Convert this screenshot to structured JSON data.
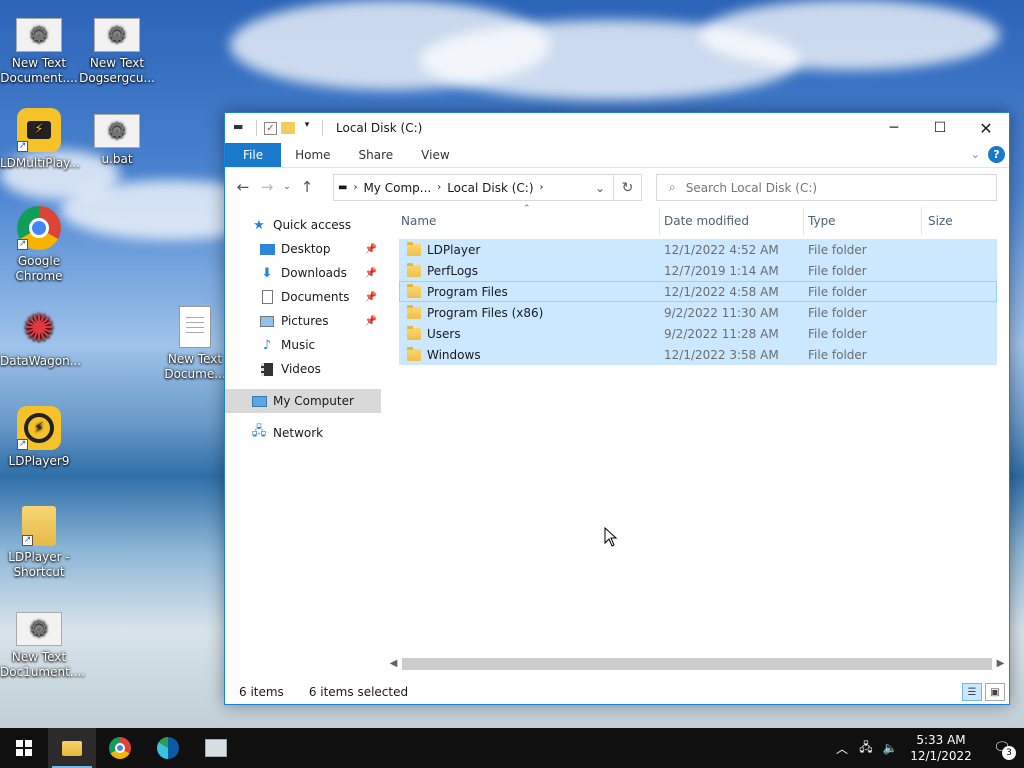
{
  "desktop": {
    "icons": [
      {
        "label": "New Text Document...."
      },
      {
        "label": "New Text Dogsergcu..."
      },
      {
        "label": "LDMultiPlay..."
      },
      {
        "label": "u.bat"
      },
      {
        "label": "Google Chrome"
      },
      {
        "label": "DataWagon..."
      },
      {
        "label": "New Text Docume..."
      },
      {
        "label": "LDPlayer9"
      },
      {
        "label": "LDPlayer - Shortcut"
      },
      {
        "label": "New Text Doc1ument...."
      }
    ]
  },
  "window": {
    "title": "Local Disk (C:)",
    "ribbon_tabs": [
      "File",
      "Home",
      "Share",
      "View"
    ],
    "address": {
      "crumbs": [
        "My Comp...",
        "Local Disk (C:)"
      ]
    },
    "search": {
      "placeholder": "Search Local Disk (C:)"
    },
    "nav": {
      "quick_access": "Quick access",
      "items": [
        "Desktop",
        "Downloads",
        "Documents",
        "Pictures",
        "Music",
        "Videos"
      ],
      "my_computer": "My Computer",
      "network": "Network"
    },
    "columns": [
      "Name",
      "Date modified",
      "Type",
      "Size"
    ],
    "rows": [
      {
        "name": "LDPlayer",
        "date": "12/1/2022 4:52 AM",
        "type": "File folder"
      },
      {
        "name": "PerfLogs",
        "date": "12/7/2019 1:14 AM",
        "type": "File folder"
      },
      {
        "name": "Program Files",
        "date": "12/1/2022 4:58 AM",
        "type": "File folder"
      },
      {
        "name": "Program Files (x86)",
        "date": "9/2/2022 11:30 AM",
        "type": "File folder"
      },
      {
        "name": "Users",
        "date": "9/2/2022 11:28 AM",
        "type": "File folder"
      },
      {
        "name": "Windows",
        "date": "12/1/2022 3:58 AM",
        "type": "File folder"
      }
    ],
    "status": {
      "items": "6 items",
      "selected": "6 items selected"
    }
  },
  "taskbar": {
    "time": "5:33 AM",
    "date": "12/1/2022",
    "notification_count": "3"
  }
}
